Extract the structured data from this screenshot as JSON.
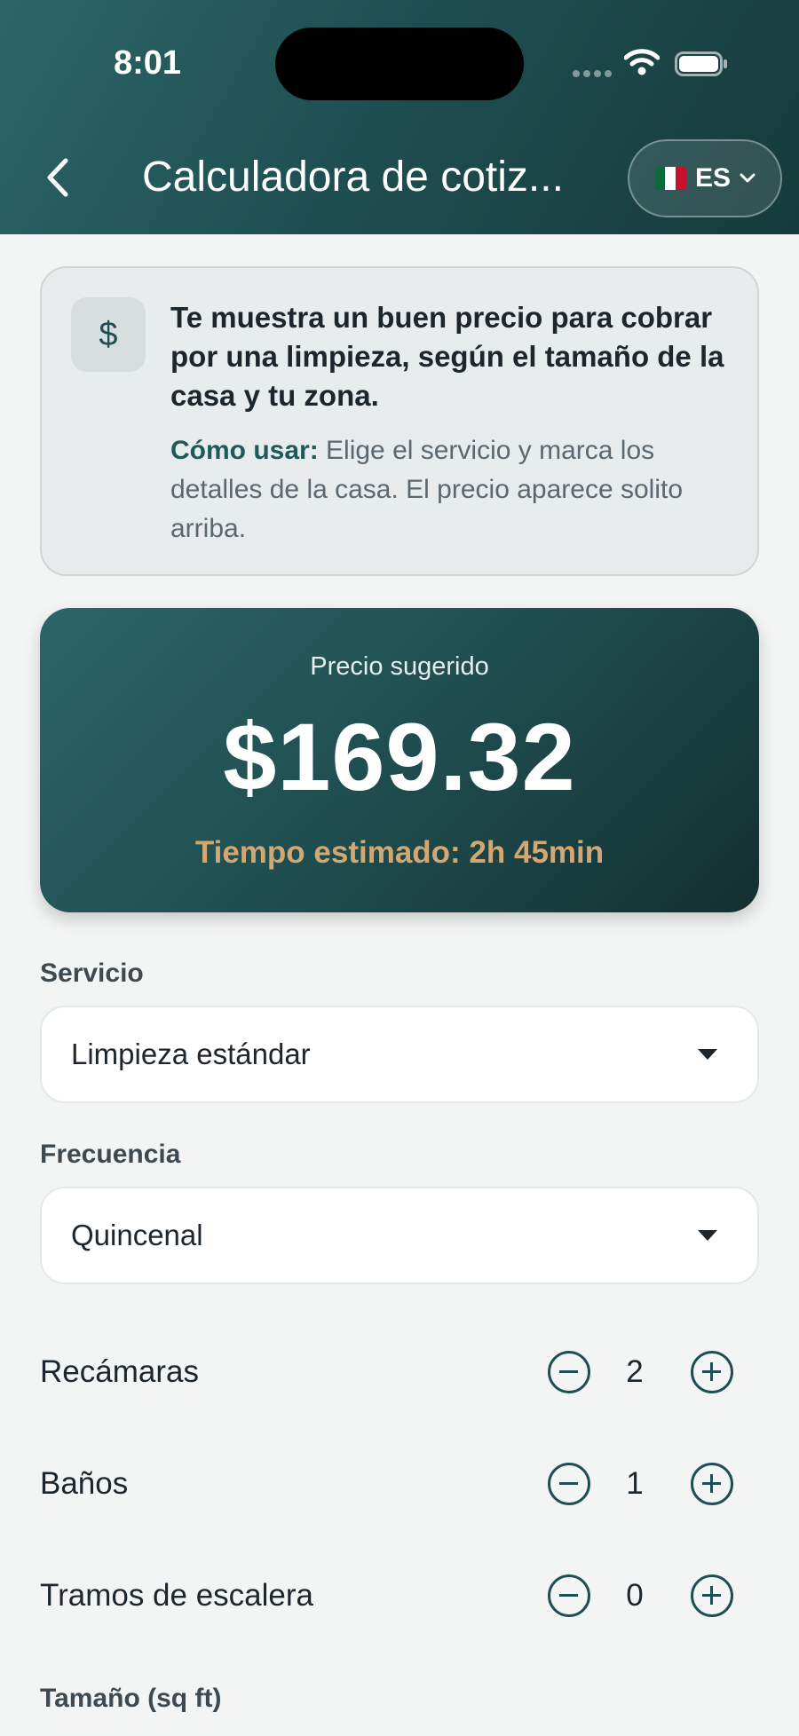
{
  "status_bar": {
    "time": "8:01"
  },
  "header": {
    "title": "Calculadora de cotiz...",
    "language": {
      "code": "ES",
      "flag": "mexico-flag-icon"
    }
  },
  "info_card": {
    "icon": "$",
    "title": "Te muestra un buen precio para cobrar por una limpieza, según el tamaño de la casa y tu zona.",
    "howto_label": "Cómo usar:",
    "howto_text": " Elige el servicio y marca los detalles de la casa. El precio aparece solito arriba."
  },
  "price_card": {
    "label": "Precio sugerido",
    "price": "$169.32",
    "time_estimate": "Tiempo estimado: 2h 45min"
  },
  "fields": {
    "service": {
      "label": "Servicio",
      "value": "Limpieza estándar"
    },
    "frequency": {
      "label": "Frecuencia",
      "value": "Quincenal"
    }
  },
  "steppers": [
    {
      "label": "Recámaras",
      "value": "2"
    },
    {
      "label": "Baños",
      "value": "1"
    },
    {
      "label": "Tramos de escalera",
      "value": "0"
    }
  ],
  "size_label": "Tamaño (sq ft)",
  "colors": {
    "header_bg": "#1f4f52",
    "accent": "#1f4f52",
    "time_estimate": "#d1a874",
    "background": "#f3f5f5"
  }
}
